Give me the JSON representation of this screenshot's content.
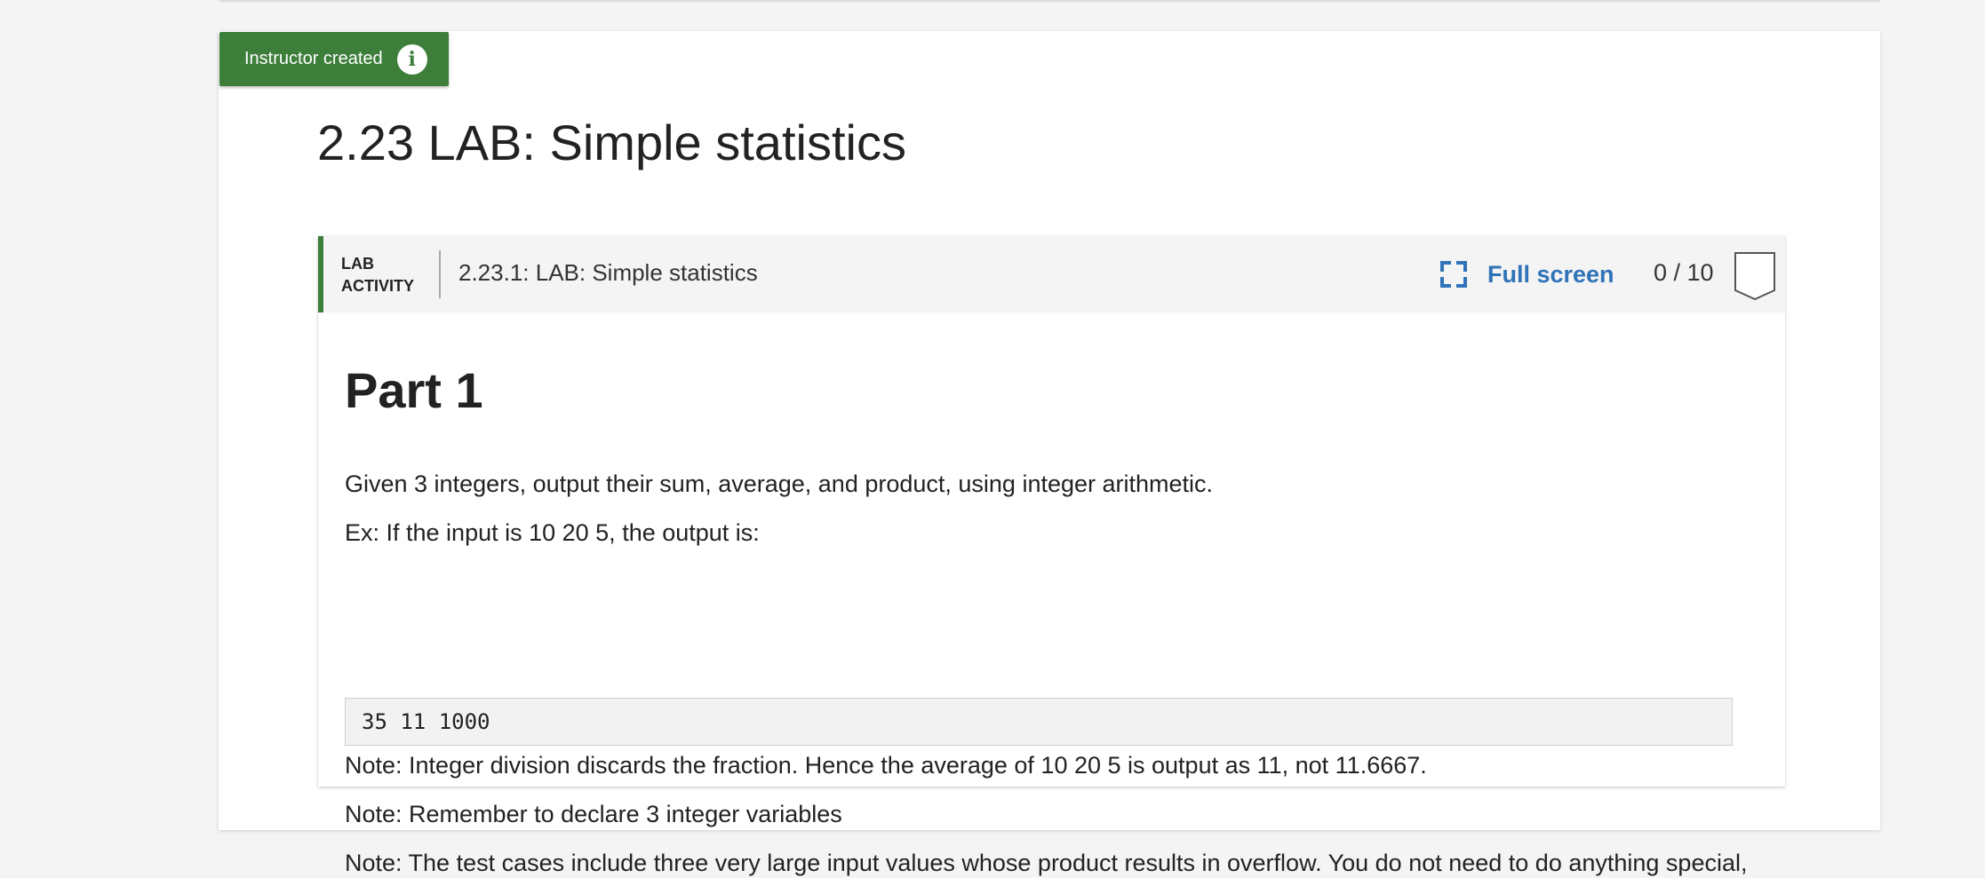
{
  "badge": {
    "label": "Instructor created",
    "icon": "info-icon"
  },
  "section": {
    "title": "2.23 LAB: Simple statistics"
  },
  "activity": {
    "type_line1": "LAB",
    "type_line2": "ACTIVITY",
    "label": "2.23.1: LAB: Simple statistics",
    "fullscreen_label": "Full screen",
    "fullscreen_icon": "expand-icon",
    "score": "0 / 10",
    "score_icon": "score-flag-icon"
  },
  "content": {
    "part_title": "Part 1",
    "paragraphs": [
      "Given 3 integers, output their sum, average, and product, using integer arithmetic.",
      "Ex: If the input is 10 20 5, the output is:"
    ],
    "code_sample": "35 11 1000",
    "notes": [
      "Note: Integer division discards the fraction. Hence the average of 10 20 5 is output as 11, not 11.6667.",
      "Note: Remember to declare 3 integer variables",
      "Note: The test cases include three very large input values whose product results in overflow. You do not need to do anything special,"
    ]
  },
  "colors": {
    "accent_green": "#3d7f3a",
    "link_blue": "#2f73b8"
  }
}
